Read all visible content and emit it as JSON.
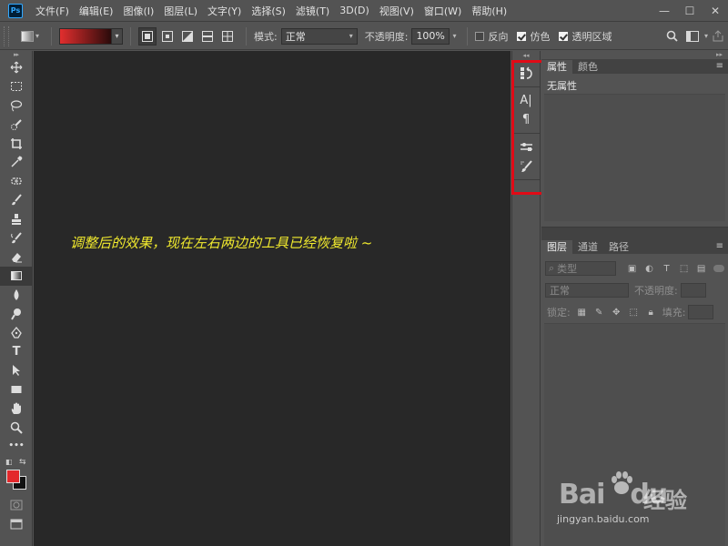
{
  "app": {
    "logo": "Ps"
  },
  "menu": [
    "文件(F)",
    "编辑(E)",
    "图像(I)",
    "图层(L)",
    "文字(Y)",
    "选择(S)",
    "滤镜(T)",
    "3D(D)",
    "视图(V)",
    "窗口(W)",
    "帮助(H)"
  ],
  "window_controls": {
    "minimize": "—",
    "maximize": "☐",
    "close": "✕"
  },
  "options": {
    "mode_label": "模式:",
    "mode_value": "正常",
    "opacity_label": "不透明度:",
    "opacity_value": "100%",
    "reverse_label": "反向",
    "dither_label": "仿色",
    "transparency_label": "透明区域",
    "reverse_checked": false,
    "dither_checked": true,
    "transparency_checked": true,
    "gradient_colors": [
      "#e22e2e",
      "#2a0b0b"
    ]
  },
  "tools": [
    {
      "name": "move-tool"
    },
    {
      "name": "marquee-tool"
    },
    {
      "name": "lasso-tool"
    },
    {
      "name": "quick-select-tool"
    },
    {
      "name": "crop-tool"
    },
    {
      "name": "eyedropper-tool"
    },
    {
      "name": "healing-brush-tool"
    },
    {
      "name": "brush-tool"
    },
    {
      "name": "clone-stamp-tool"
    },
    {
      "name": "history-brush-tool"
    },
    {
      "name": "eraser-tool"
    },
    {
      "name": "gradient-tool"
    },
    {
      "name": "blur-tool"
    },
    {
      "name": "dodge-tool"
    },
    {
      "name": "pen-tool"
    },
    {
      "name": "type-tool",
      "glyph": "T"
    },
    {
      "name": "path-select-tool"
    },
    {
      "name": "rectangle-tool"
    },
    {
      "name": "hand-tool"
    },
    {
      "name": "zoom-tool"
    },
    {
      "name": "more-tools",
      "glyph": "•••"
    }
  ],
  "colors": {
    "foreground": "#e3282b",
    "background": "#111111",
    "mini_glyph": "◧",
    "swap_glyph": "⇆"
  },
  "canvas": {
    "caption": "调整后的效果，现在左右两边的工具已经恢复啦 ~",
    "caption_color": "#f1ea2e",
    "background": "#282828"
  },
  "dock": {
    "highlight_color": "#e10a16",
    "icons": [
      "history-icon",
      "character-icon",
      "paragraph-icon",
      "adjustments-icon",
      "brush-preset-icon"
    ]
  },
  "properties_panel": {
    "tabs": [
      "属性",
      "颜色"
    ],
    "active_tab": "属性",
    "content": "无属性"
  },
  "layers_panel": {
    "tabs": [
      "图层",
      "通道",
      "路径"
    ],
    "active_tab": "图层",
    "filter_placeholder": "类型",
    "blend_mode": "正常",
    "opacity_label": "不透明度:",
    "lock_label": "锁定:",
    "fill_label": "填充:",
    "footer_icons": [
      "link-icon",
      "fx-icon",
      "mask-icon",
      "adjustment-layer-icon",
      "group-icon",
      "new-layer-icon",
      "trash-icon"
    ]
  },
  "watermark": {
    "brand": "Bai",
    "brand2": "du",
    "product": "经验",
    "url": "jingyan.baidu.com"
  }
}
